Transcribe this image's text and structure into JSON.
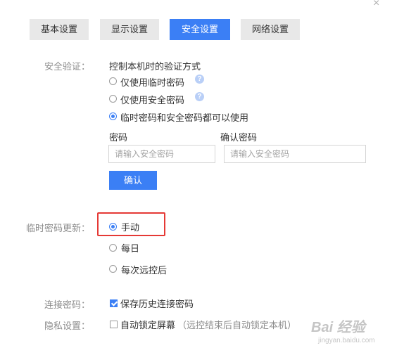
{
  "window": {
    "close_glyph": "×"
  },
  "tabs": [
    {
      "label": "基本设置",
      "active": false
    },
    {
      "label": "显示设置",
      "active": false
    },
    {
      "label": "安全设置",
      "active": true
    },
    {
      "label": "网络设置",
      "active": false
    }
  ],
  "security": {
    "label": "安全验证：",
    "description": "控制本机时的验证方式",
    "options": [
      {
        "label": "仅使用临时密码",
        "checked": false,
        "help": "?"
      },
      {
        "label": "仅使用安全密码",
        "checked": false,
        "help": "?"
      },
      {
        "label": "临时密码和安全密码都可以使用",
        "checked": true
      }
    ],
    "password_label": "密码",
    "password_placeholder": "请输入安全密码",
    "confirm_label": "确认密码",
    "confirm_placeholder": "请输入安全密码",
    "confirm_button": "确认"
  },
  "temp_password": {
    "label": "临时密码更新：",
    "options": [
      {
        "label": "手动",
        "checked": true
      },
      {
        "label": "每日",
        "checked": false
      },
      {
        "label": "每次远控后",
        "checked": false
      }
    ]
  },
  "connection": {
    "label": "连接密码：",
    "checkbox_label": "保存历史连接密码",
    "checked": true
  },
  "privacy": {
    "label": "隐私设置：",
    "checkbox_label": "自动锁定屏幕",
    "hint": "（远控结束后自动锁定本机）",
    "checked": false
  },
  "colors": {
    "accent": "#3b7ff5",
    "highlight": "#e53935"
  },
  "watermark": {
    "logo": "Bai 经验",
    "url": "jingyan.baidu.com"
  }
}
